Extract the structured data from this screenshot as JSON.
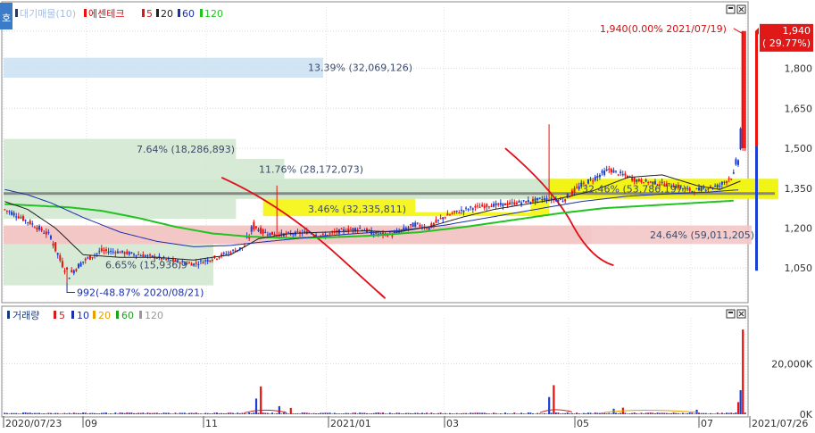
{
  "top_legend": {
    "main": "대기매물(10)",
    "stock": "에센테크",
    "ma": [
      "5",
      "20",
      "60",
      "120"
    ]
  },
  "bottom_legend": {
    "main": "거래량",
    "ma": [
      "5",
      "10",
      "20",
      "60",
      "120"
    ]
  },
  "side_tab": "호",
  "colors": {
    "up": "#e8120e",
    "down": "#1c3fd1",
    "ma5": "#d41c1c",
    "ma20": "#222222",
    "ma60": "#1b2fa8",
    "ma120": "#21c321",
    "pink_band": "#f4c6c6",
    "blue_band": "#c9e1f2",
    "green_band": "#cfe6cf",
    "yellow": "#f5f500",
    "red_trend": "#e0101a"
  },
  "chart_data": [
    {
      "type": "candlestick",
      "name": "price",
      "ylim": [
        930,
        2030
      ],
      "y_ticks": [
        1050,
        1200,
        1350,
        1500,
        1650,
        1800,
        1940
      ],
      "y_tick_labels": [
        "1,050",
        "1,200",
        "1,350",
        "1,500",
        "1,650",
        "1,800",
        "1,940"
      ],
      "x_labels": [
        "2020/07/23",
        "09",
        "11",
        "2021/01",
        "03",
        "05",
        "07",
        "2021/07/26"
      ],
      "current_price": {
        "label": "1,940",
        "change": "( 29.77%)"
      },
      "high_annotation": "1,940(0.00% 2021/07/19)",
      "low_annotation": "992(-48.87% 2020/08/21)",
      "volume_profile": [
        {
          "label": "13.39% (32,069,126)",
          "y_low": 1765,
          "y_high": 1840,
          "pct": 13.39
        },
        {
          "label": "7.64% (18,286,893)",
          "y_low": 1460,
          "y_high": 1535,
          "pct": 7.64
        },
        {
          "label": "11.76% (28,172,073)",
          "y_low": 1385,
          "y_high": 1460,
          "pct": 11.76
        },
        {
          "label": "32.46% (53,786,197)",
          "y_low": 1310,
          "y_high": 1385,
          "pct": 32.46
        },
        {
          "label": "3.46% (32,335,811)",
          "y_low": 1235,
          "y_high": 1310,
          "pct": 3.46
        },
        {
          "label": "24.64% (59,011,205)",
          "y_low": 1140,
          "y_high": 1210,
          "pct": 24.64
        },
        {
          "label": "6.65% (15,936,9",
          "y_low": 985,
          "y_high": 1140,
          "pct": 6.65
        }
      ],
      "close_path": [
        [
          0,
          1270
        ],
        [
          5,
          1250
        ],
        [
          12,
          1215
        ],
        [
          20,
          1170
        ],
        [
          24,
          1080
        ],
        [
          28,
          1025
        ],
        [
          34,
          1075
        ],
        [
          42,
          1115
        ],
        [
          50,
          1110
        ],
        [
          58,
          1100
        ],
        [
          66,
          1090
        ],
        [
          74,
          1075
        ],
        [
          82,
          1065
        ],
        [
          90,
          1085
        ],
        [
          98,
          1110
        ],
        [
          104,
          1130
        ],
        [
          108,
          1210
        ],
        [
          112,
          1185
        ],
        [
          118,
          1175
        ],
        [
          126,
          1180
        ],
        [
          132,
          1185
        ],
        [
          138,
          1170
        ],
        [
          146,
          1190
        ],
        [
          154,
          1200
        ],
        [
          160,
          1180
        ],
        [
          168,
          1175
        ],
        [
          172,
          1190
        ],
        [
          178,
          1215
        ],
        [
          184,
          1200
        ],
        [
          190,
          1240
        ],
        [
          196,
          1260
        ],
        [
          202,
          1275
        ],
        [
          210,
          1285
        ],
        [
          218,
          1290
        ],
        [
          226,
          1300
        ],
        [
          234,
          1310
        ],
        [
          242,
          1305
        ],
        [
          250,
          1360
        ],
        [
          256,
          1390
        ],
        [
          262,
          1420
        ],
        [
          268,
          1400
        ],
        [
          274,
          1380
        ],
        [
          282,
          1370
        ],
        [
          290,
          1360
        ],
        [
          298,
          1340
        ],
        [
          304,
          1350
        ],
        [
          310,
          1360
        ],
        [
          316,
          1400
        ],
        [
          318,
          1460
        ],
        [
          319,
          1560
        ],
        [
          320,
          1870
        ],
        [
          320.5,
          1940
        ]
      ],
      "ma120_path": [
        [
          0,
          1290
        ],
        [
          12,
          1285
        ],
        [
          28,
          1278
        ],
        [
          42,
          1265
        ],
        [
          58,
          1238
        ],
        [
          74,
          1205
        ],
        [
          90,
          1180
        ],
        [
          106,
          1168
        ],
        [
          122,
          1163
        ],
        [
          140,
          1165
        ],
        [
          160,
          1172
        ],
        [
          180,
          1185
        ],
        [
          200,
          1205
        ],
        [
          220,
          1230
        ],
        [
          240,
          1255
        ],
        [
          260,
          1275
        ],
        [
          280,
          1285
        ],
        [
          300,
          1295
        ],
        [
          320,
          1305
        ]
      ],
      "ma60_path": [
        [
          0,
          1345
        ],
        [
          10,
          1325
        ],
        [
          20,
          1295
        ],
        [
          34,
          1240
        ],
        [
          50,
          1185
        ],
        [
          66,
          1150
        ],
        [
          82,
          1130
        ],
        [
          98,
          1135
        ],
        [
          114,
          1150
        ],
        [
          132,
          1165
        ],
        [
          150,
          1178
        ],
        [
          170,
          1190
        ],
        [
          190,
          1210
        ],
        [
          210,
          1240
        ],
        [
          230,
          1270
        ],
        [
          250,
          1300
        ],
        [
          270,
          1320
        ],
        [
          290,
          1330
        ],
        [
          305,
          1335
        ],
        [
          320,
          1345
        ]
      ],
      "ma20_path": [
        [
          0,
          1300
        ],
        [
          10,
          1270
        ],
        [
          22,
          1200
        ],
        [
          34,
          1100
        ],
        [
          50,
          1090
        ],
        [
          66,
          1090
        ],
        [
          82,
          1080
        ],
        [
          98,
          1100
        ],
        [
          110,
          1160
        ],
        [
          124,
          1180
        ],
        [
          140,
          1185
        ],
        [
          156,
          1190
        ],
        [
          170,
          1185
        ],
        [
          184,
          1205
        ],
        [
          198,
          1240
        ],
        [
          212,
          1270
        ],
        [
          226,
          1290
        ],
        [
          240,
          1310
        ],
        [
          255,
          1340
        ],
        [
          270,
          1390
        ],
        [
          285,
          1400
        ],
        [
          300,
          1360
        ],
        [
          310,
          1345
        ],
        [
          320,
          1380
        ]
      ]
    },
    {
      "type": "bar",
      "name": "volume",
      "ylim": [
        0,
        36000
      ],
      "y_ticks": [
        0,
        20000
      ],
      "y_tick_labels": [
        "0K",
        "20,000K"
      ],
      "spikes": [
        {
          "x": 109,
          "v": 6200
        },
        {
          "x": 111,
          "v": 11000
        },
        {
          "x": 119,
          "v": 3200
        },
        {
          "x": 124,
          "v": 2500
        },
        {
          "x": 236,
          "v": 6800
        },
        {
          "x": 238,
          "v": 11500
        },
        {
          "x": 264,
          "v": 2200
        },
        {
          "x": 268,
          "v": 2600
        },
        {
          "x": 300,
          "v": 1800
        },
        {
          "x": 318,
          "v": 4800
        },
        {
          "x": 319,
          "v": 9500
        },
        {
          "x": 320,
          "v": 33500
        }
      ]
    }
  ]
}
